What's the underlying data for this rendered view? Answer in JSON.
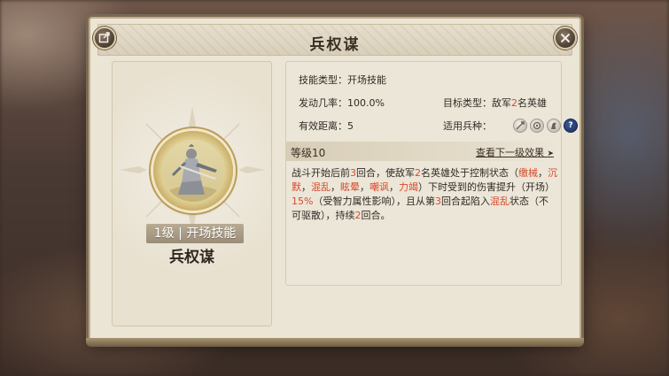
{
  "dialog": {
    "title": "兵权谋"
  },
  "skill_card": {
    "level_badge": "1级 | 开场技能",
    "name": "兵权谋"
  },
  "info": {
    "type_label": "技能类型：",
    "type_value": "开场技能",
    "rate_label": "发动几率：",
    "rate_value": "100.0%",
    "target_label": "目标类型：",
    "target_prefix": "敌军",
    "target_count": "2",
    "target_suffix": "名英雄",
    "range_label": "有效距离：",
    "range_value": "5",
    "troop_label": "适用兵种：",
    "troop_icons": [
      "spear-icon",
      "shield-icon",
      "horse-icon",
      "question-icon"
    ]
  },
  "level": {
    "label": "等级10",
    "next_label": "查看下一级效果",
    "next_arrow": "➤"
  },
  "description": {
    "p1": "战斗开始后前",
    "n_rounds": "3",
    "p2": "回合，使敌军",
    "n_heroes": "2",
    "p3": "名英雄处于控制状态（",
    "s1": "缴械",
    "sep1": "，",
    "s2": "沉默",
    "sep2": "，",
    "s3": "混乱",
    "sep3": "，",
    "s4": "眩晕",
    "sep4": "，",
    "s5": "嘲讽",
    "sep5": "，",
    "s6": "力竭",
    "p4": "）下时受到的伤害提升（开场）",
    "pct": "15%",
    "p5": "（受智力属性影响），且从第",
    "n_round_from": "3",
    "p6": "回合起陷入",
    "s7": "混乱",
    "p7": "状态（不可驱散），持续",
    "n_duration": "2",
    "p8": "回合。"
  },
  "colors": {
    "accent": "#d74a2b",
    "panel": "#ebe5d6",
    "text": "#2f2a24"
  }
}
